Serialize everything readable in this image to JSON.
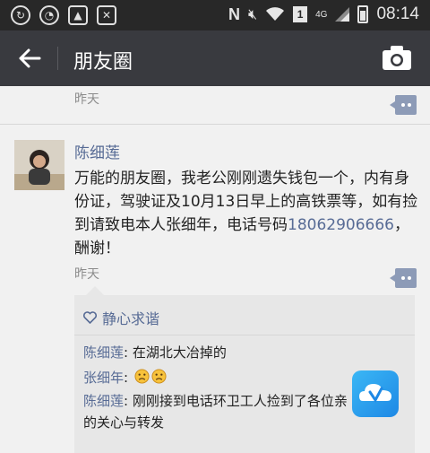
{
  "status_bar": {
    "time": "08:14",
    "network": "4G",
    "sim_badge": "1",
    "carrier_letter": "N"
  },
  "header": {
    "title": "朋友圈"
  },
  "prev_post": {
    "time": "昨天"
  },
  "post": {
    "author": "陈细莲",
    "text_before_phone": "万能的朋友圈，我老公刚刚遗失钱包一个，内有身份证，驾驶证及10月13日早上的高铁票等，如有捡到请致电本人张细年，电话号码",
    "phone": "18062906666",
    "text_after_phone": "，酬谢！",
    "time": "昨天"
  },
  "likes": {
    "names": "静心求谐"
  },
  "comments": [
    {
      "author": "陈细莲",
      "sep": ": ",
      "text": "在湖北大冶掉的"
    },
    {
      "author": "张细年",
      "sep": ": ",
      "text": "",
      "emojis": [
        "sad-face",
        "sad-face"
      ]
    },
    {
      "author": "陈细莲",
      "sep": ": ",
      "text": "刚刚接到电话环卫工人捡到了各位亲的关心与转发"
    }
  ],
  "colors": {
    "link_blue": "#576b95",
    "title_bar": "#393a3f",
    "status_bar": "#282828"
  }
}
